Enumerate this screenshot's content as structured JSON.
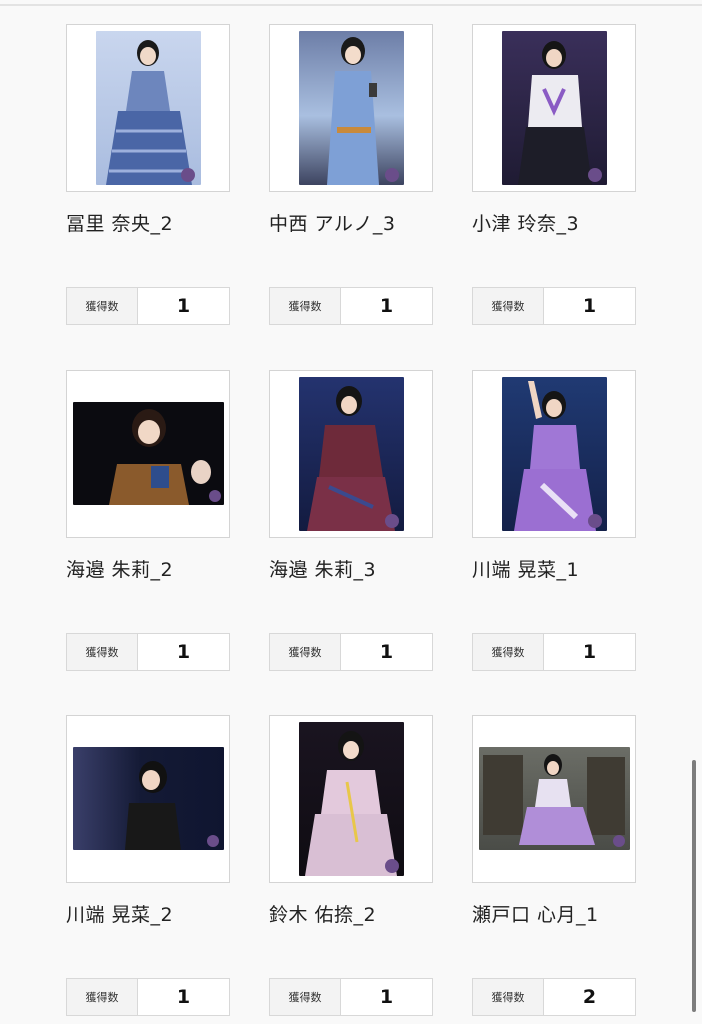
{
  "cards": [
    {
      "name": "冨里 奈央_2",
      "count_label": "獲得数",
      "count": "1",
      "photo": {
        "bg": "#b9c8e4",
        "accent": "#4f6ea8",
        "orient": "portrait"
      }
    },
    {
      "name": "中西 アルノ_3",
      "count_label": "獲得数",
      "count": "1",
      "photo": {
        "bg": "#9fb6d9",
        "accent": "#6d90c8",
        "orient": "portrait"
      }
    },
    {
      "name": "小津 玲奈_3",
      "count_label": "獲得数",
      "count": "1",
      "photo": {
        "bg": "#2a2a4a",
        "accent": "#e9e6ef",
        "orient": "portrait"
      }
    },
    {
      "name": "海邉 朱莉_2",
      "count_label": "獲得数",
      "count": "1",
      "photo": {
        "bg": "#0c0c12",
        "accent": "#8a5a2c",
        "orient": "landscape"
      }
    },
    {
      "name": "海邉 朱莉_3",
      "count_label": "獲得数",
      "count": "1",
      "photo": {
        "bg": "#1f2b63",
        "accent": "#6e2a3a",
        "orient": "portrait"
      }
    },
    {
      "name": "川端 晃菜_1",
      "count_label": "獲得数",
      "count": "1",
      "photo": {
        "bg": "#1c2c5c",
        "accent": "#a077d6",
        "orient": "portrait"
      }
    },
    {
      "name": "川端 晃菜_2",
      "count_label": "獲得数",
      "count": "1",
      "photo": {
        "bg": "#1b2140",
        "accent": "#181818",
        "orient": "landscape"
      }
    },
    {
      "name": "鈴木 佑捺_2",
      "count_label": "獲得数",
      "count": "1",
      "photo": {
        "bg": "#151218",
        "accent": "#d9bfd4",
        "orient": "portrait"
      }
    },
    {
      "name": "瀬戸口 心月_1",
      "count_label": "獲得数",
      "count": "2",
      "photo": {
        "bg": "#5a5d57",
        "accent": "#b08ed8",
        "orient": "landscape"
      }
    }
  ]
}
